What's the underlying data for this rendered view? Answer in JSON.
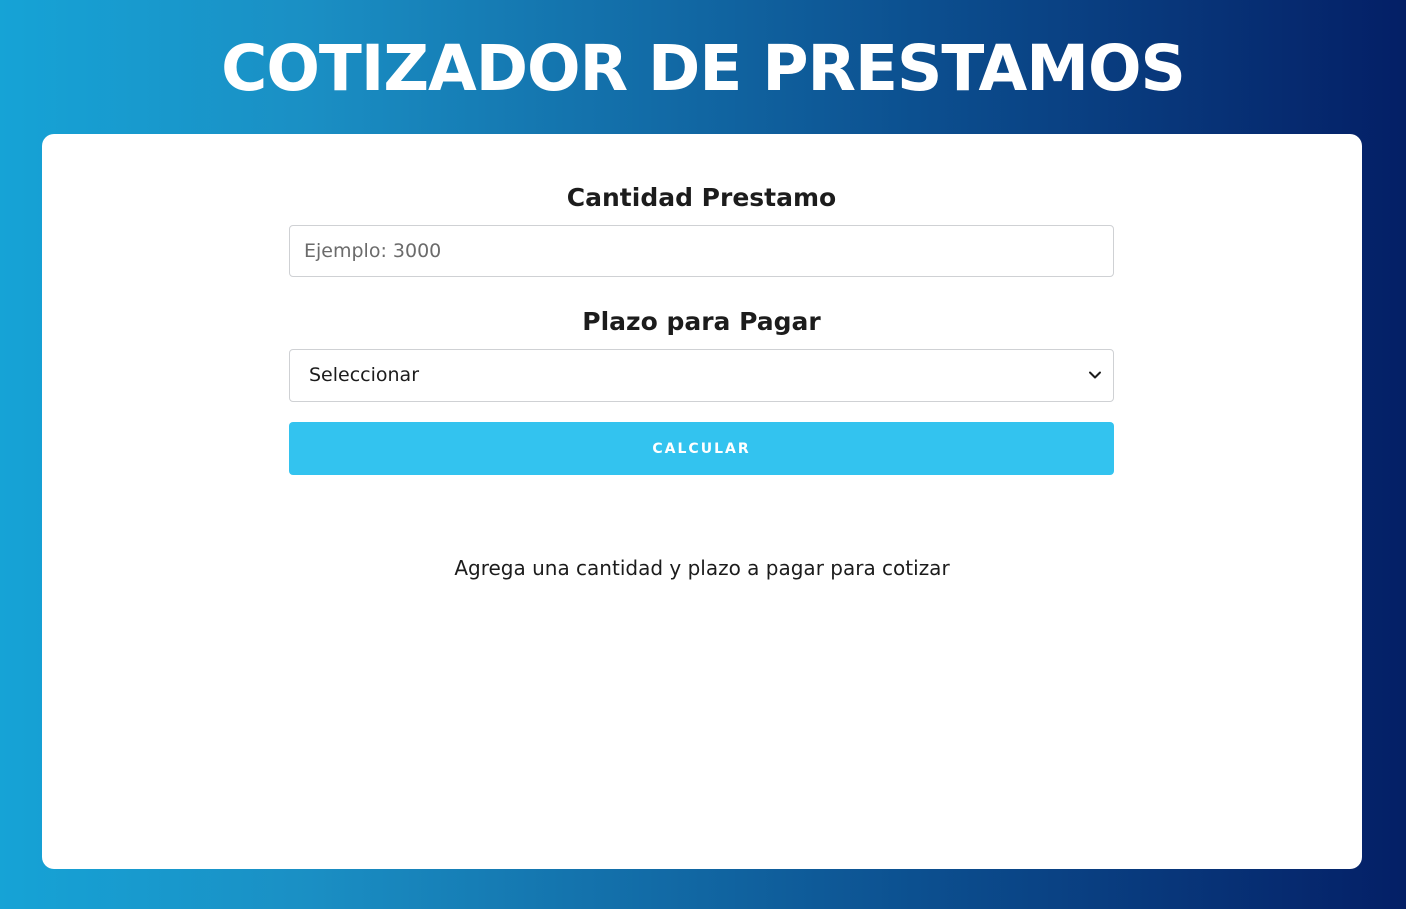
{
  "header": {
    "title": "COTIZADOR DE PRESTAMOS"
  },
  "form": {
    "amount_label": "Cantidad Prestamo",
    "amount_placeholder": "Ejemplo: 3000",
    "amount_value": "",
    "term_label": "Plazo para Pagar",
    "term_selected": "Seleccionar",
    "calculate_label": "CALCULAR"
  },
  "result": {
    "message": "Agrega una cantidad y plazo a pagar para cotizar"
  },
  "icons": {
    "select_indicator": "chevron-down-icon"
  },
  "colors": {
    "gradient_start": "#16a3d6",
    "gradient_end": "#041f66",
    "button": "#33c3ef",
    "card": "#ffffff"
  }
}
